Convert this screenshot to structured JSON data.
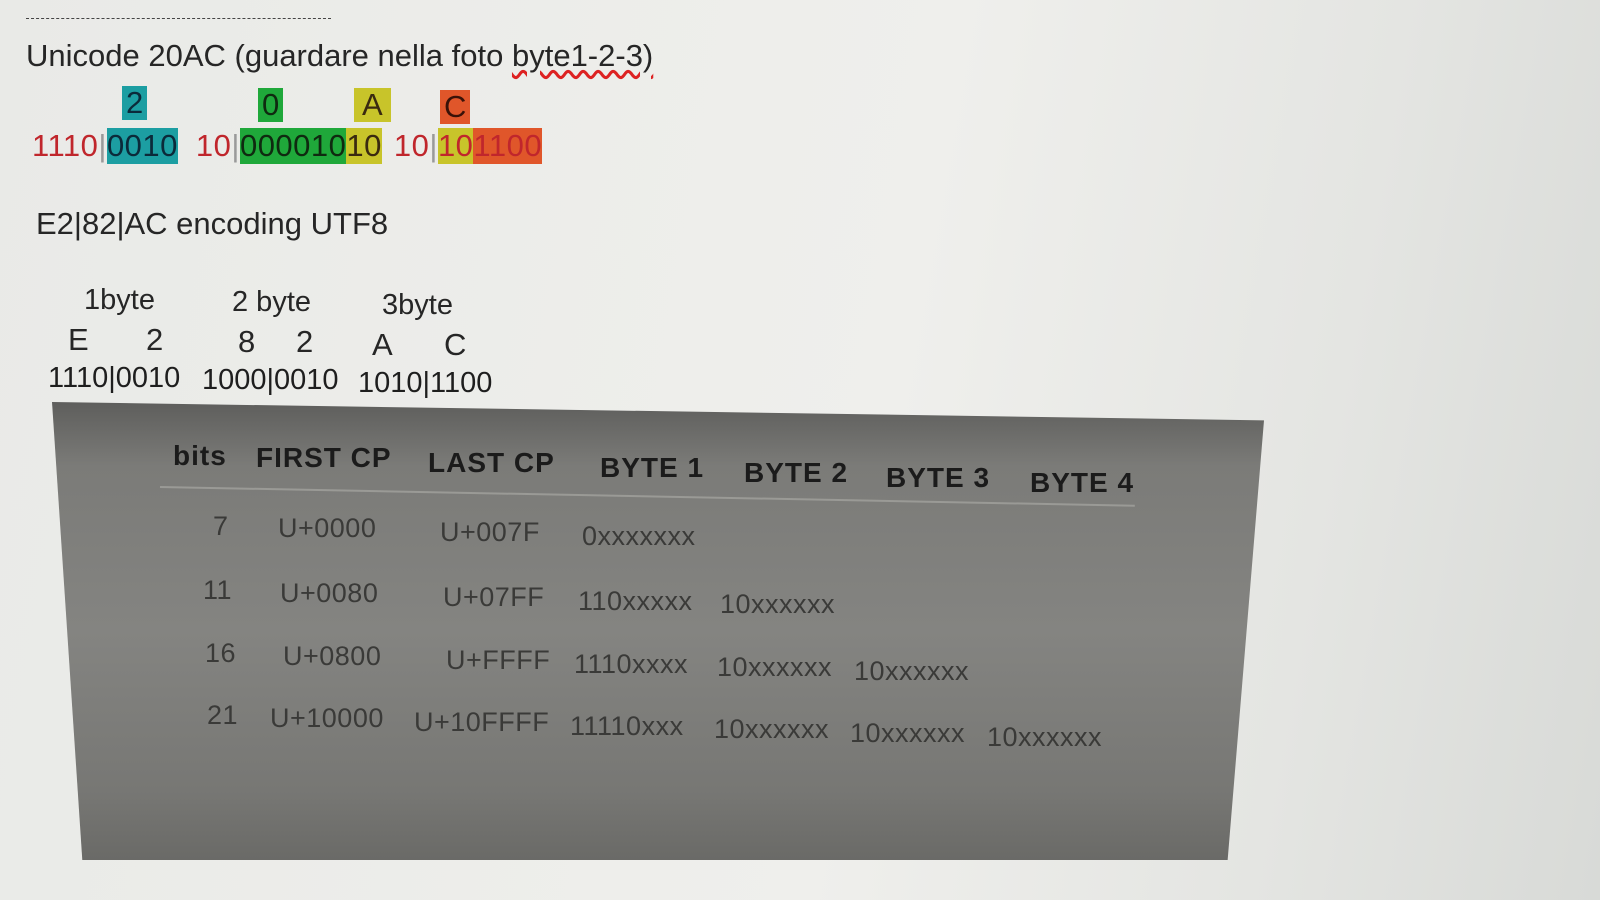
{
  "heading": {
    "prefix": "Unicode 20AC (guardare nella foto ",
    "link": "byte1-2-3)"
  },
  "hex_labels": [
    {
      "text": "2",
      "color": "#1c9ea2"
    },
    {
      "text": "0",
      "color": "#1fa83a"
    },
    {
      "text": "A",
      "color": "#c8c42a"
    },
    {
      "text": "C",
      "color": "#e0562a"
    }
  ],
  "binary_line": {
    "seg1": "1110",
    "sep1": "|",
    "seg2": "0010",
    "seg3": "10",
    "sep2": "|",
    "seg4": "0000",
    "seg5": "10",
    "seg6": "10",
    "sep3": "|",
    "seg7": "10",
    "seg8": "1100"
  },
  "encoding_line": "E2|82|AC encoding UTF8",
  "byte_grid": {
    "headers": [
      "1byte",
      "2 byte",
      "3byte"
    ],
    "chars": [
      "E",
      "2",
      "8",
      "2",
      "A",
      "C"
    ],
    "binaries": [
      "1110|0010",
      "1000|0010",
      "1010|1100"
    ]
  },
  "table": {
    "columns": [
      "bits",
      "FIRST CP",
      "LAST CP",
      "BYTE 1",
      "BYTE 2",
      "BYTE 3",
      "BYTE 4"
    ],
    "rows": [
      [
        "7",
        "U+0000",
        "U+007F",
        "0xxxxxxx",
        "",
        "",
        ""
      ],
      [
        "11",
        "U+0080",
        "U+07FF",
        "110xxxxx",
        "10xxxxxx",
        "",
        ""
      ],
      [
        "16",
        "U+0800",
        "U+FFFF",
        "1110xxxx",
        "10xxxxxx",
        "10xxxxxx",
        ""
      ],
      [
        "21",
        "U+10000",
        "U+10FFFF",
        "11110xxx",
        "10xxxxxx",
        "10xxxxxx",
        "10xxxxxx"
      ]
    ]
  },
  "colors": {
    "red_text": "#c0262c",
    "teal": "#1c9ea2",
    "green": "#1fa83a",
    "yellow": "#c8c42a",
    "orange": "#e0562a"
  }
}
